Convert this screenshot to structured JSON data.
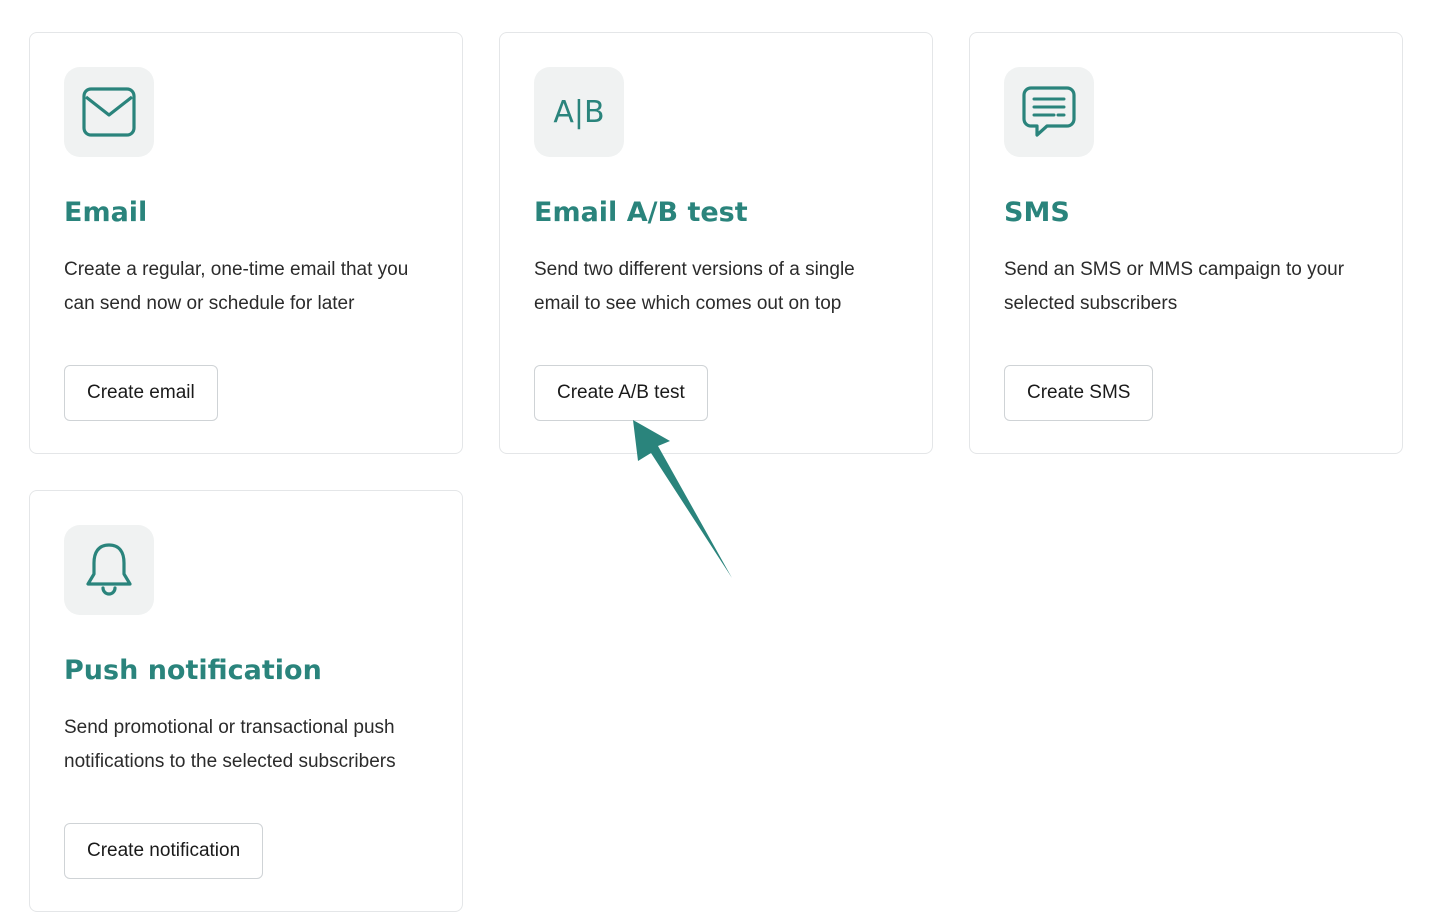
{
  "cards": [
    {
      "icon": "envelope-icon",
      "title": "Email",
      "description": "Create a regular, one-time email that you can send now or schedule for later",
      "button": "Create email"
    },
    {
      "icon": "ab-test-icon",
      "icon_text": "A|B",
      "title": "Email A/B test",
      "description": "Send two different versions of a single email to see which comes out on top",
      "button": "Create A/B test"
    },
    {
      "icon": "chat-bubble-icon",
      "title": "SMS",
      "description": "Send an SMS or MMS campaign to your selected subscribers",
      "button": "Create SMS"
    },
    {
      "icon": "bell-icon",
      "title": "Push notification",
      "description": "Send promotional or transactional push notifications to the selected subscribers",
      "button": "Create notification"
    }
  ],
  "annotation": {
    "icon": "pointer-arrow-icon",
    "target": "Create A/B test"
  },
  "colors": {
    "accent": "#2a847c",
    "icon_bg": "#f0f2f2",
    "border": "#e4e6e8",
    "text": "#2b2b2b"
  }
}
